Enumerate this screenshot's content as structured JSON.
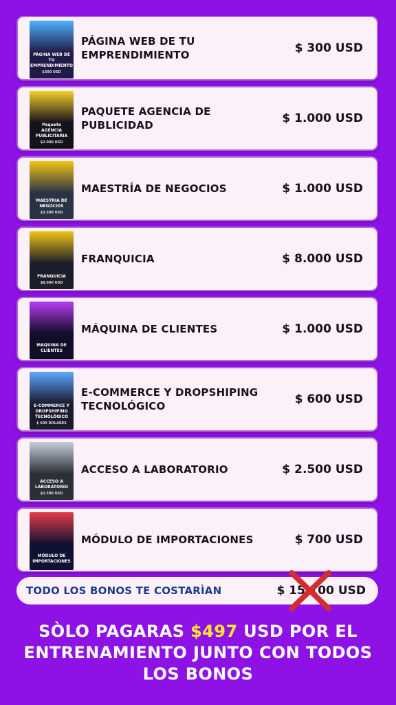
{
  "items": [
    {
      "name": "PÁGINA WEB DE TU EMPRENDIMIENTO",
      "price": "$ 300 USD",
      "thumb_title": "PÁGINA WEB DE TU EMPRENDIMIENTO",
      "thumb_price": "$300 USD",
      "thumb_bg": "#201a46",
      "thumb_accent": "#4fb3ff"
    },
    {
      "name": "PAQUETE AGENCIA DE PUBLICIDAD",
      "price": "$ 1.000 USD",
      "thumb_title": "Paquete AGENCIA PUBLICITARIA",
      "thumb_price": "$2.000 USD",
      "thumb_bg": "#15121c",
      "thumb_accent": "#f5d02a"
    },
    {
      "name": "MAESTRÍA DE NEGOCIOS",
      "price": "$ 1.000 USD",
      "thumb_title": "MAESTRIA DE NEGOCIOS",
      "thumb_price": "$3.500 USD",
      "thumb_bg": "#2a3345",
      "thumb_accent": "#f2c417"
    },
    {
      "name": "FRANQUICIA",
      "price": "$ 8.000 USD",
      "thumb_title": "FRANQUICIA",
      "thumb_price": "$8.000 USD",
      "thumb_bg": "#1b1d29",
      "thumb_accent": "#f2c417"
    },
    {
      "name": "MÁQUINA DE CLIENTES",
      "price": "$ 1.000 USD",
      "thumb_title": "MAQUINA DE CLIENTES",
      "thumb_price": "",
      "thumb_bg": "#120d28",
      "thumb_accent": "#b63df0"
    },
    {
      "name": "E-COMMERCE Y DROPSHIPING TECNOLÓGICO",
      "price": "$ 600 USD",
      "thumb_title": "E-COMMERCE Y DROPSHIPING TECNOLÓGICO",
      "thumb_price": "$ 600 DOLARES",
      "thumb_bg": "#1a1c2e",
      "thumb_accent": "#5ea7ff"
    },
    {
      "name": "ACCESO A LABORATORIO",
      "price": "$ 2.500 USD",
      "thumb_title": "ACCESO A LABORATORIO",
      "thumb_price": "$2.500 USD",
      "thumb_bg": "#2b2f38",
      "thumb_accent": "#c7ced8"
    },
    {
      "name": "MÓDULO DE IMPORTACIONES",
      "price": "$ 700 USD",
      "thumb_title": "MÓDULO DE IMPORTACIONES",
      "thumb_price": "",
      "thumb_bg": "#0f1230",
      "thumb_accent": "#e63b4a"
    }
  ],
  "total": {
    "label": "TODO LOS BONOS TE COSTARÌAN",
    "price": "$ 15.100 USD"
  },
  "footer": {
    "part1": "SÒLO PAGARAS ",
    "highlight": "$497",
    "part2": " USD POR EL ENTRENAMIENTO JUNTO CON TODOS LOS BONOS"
  },
  "colors": {
    "background": "#8e12e6",
    "card": "#fcf1f9",
    "highlight": "#ffe62e",
    "strike": "#d12f2f",
    "total_label": "#1e3a8a"
  }
}
